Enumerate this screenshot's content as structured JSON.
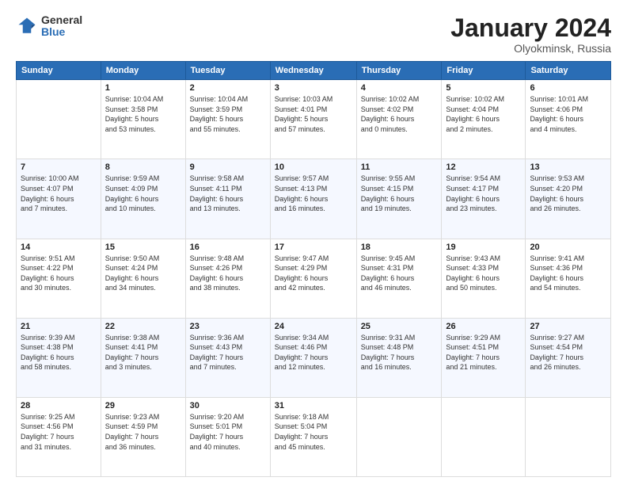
{
  "header": {
    "logo_general": "General",
    "logo_blue": "Blue",
    "month": "January 2024",
    "location": "Olyokminsk, Russia"
  },
  "weekdays": [
    "Sunday",
    "Monday",
    "Tuesday",
    "Wednesday",
    "Thursday",
    "Friday",
    "Saturday"
  ],
  "weeks": [
    [
      {
        "day": "",
        "info": ""
      },
      {
        "day": "1",
        "info": "Sunrise: 10:04 AM\nSunset: 3:58 PM\nDaylight: 5 hours\nand 53 minutes."
      },
      {
        "day": "2",
        "info": "Sunrise: 10:04 AM\nSunset: 3:59 PM\nDaylight: 5 hours\nand 55 minutes."
      },
      {
        "day": "3",
        "info": "Sunrise: 10:03 AM\nSunset: 4:01 PM\nDaylight: 5 hours\nand 57 minutes."
      },
      {
        "day": "4",
        "info": "Sunrise: 10:02 AM\nSunset: 4:02 PM\nDaylight: 6 hours\nand 0 minutes."
      },
      {
        "day": "5",
        "info": "Sunrise: 10:02 AM\nSunset: 4:04 PM\nDaylight: 6 hours\nand 2 minutes."
      },
      {
        "day": "6",
        "info": "Sunrise: 10:01 AM\nSunset: 4:06 PM\nDaylight: 6 hours\nand 4 minutes."
      }
    ],
    [
      {
        "day": "7",
        "info": "Sunrise: 10:00 AM\nSunset: 4:07 PM\nDaylight: 6 hours\nand 7 minutes."
      },
      {
        "day": "8",
        "info": "Sunrise: 9:59 AM\nSunset: 4:09 PM\nDaylight: 6 hours\nand 10 minutes."
      },
      {
        "day": "9",
        "info": "Sunrise: 9:58 AM\nSunset: 4:11 PM\nDaylight: 6 hours\nand 13 minutes."
      },
      {
        "day": "10",
        "info": "Sunrise: 9:57 AM\nSunset: 4:13 PM\nDaylight: 6 hours\nand 16 minutes."
      },
      {
        "day": "11",
        "info": "Sunrise: 9:55 AM\nSunset: 4:15 PM\nDaylight: 6 hours\nand 19 minutes."
      },
      {
        "day": "12",
        "info": "Sunrise: 9:54 AM\nSunset: 4:17 PM\nDaylight: 6 hours\nand 23 minutes."
      },
      {
        "day": "13",
        "info": "Sunrise: 9:53 AM\nSunset: 4:20 PM\nDaylight: 6 hours\nand 26 minutes."
      }
    ],
    [
      {
        "day": "14",
        "info": "Sunrise: 9:51 AM\nSunset: 4:22 PM\nDaylight: 6 hours\nand 30 minutes."
      },
      {
        "day": "15",
        "info": "Sunrise: 9:50 AM\nSunset: 4:24 PM\nDaylight: 6 hours\nand 34 minutes."
      },
      {
        "day": "16",
        "info": "Sunrise: 9:48 AM\nSunset: 4:26 PM\nDaylight: 6 hours\nand 38 minutes."
      },
      {
        "day": "17",
        "info": "Sunrise: 9:47 AM\nSunset: 4:29 PM\nDaylight: 6 hours\nand 42 minutes."
      },
      {
        "day": "18",
        "info": "Sunrise: 9:45 AM\nSunset: 4:31 PM\nDaylight: 6 hours\nand 46 minutes."
      },
      {
        "day": "19",
        "info": "Sunrise: 9:43 AM\nSunset: 4:33 PM\nDaylight: 6 hours\nand 50 minutes."
      },
      {
        "day": "20",
        "info": "Sunrise: 9:41 AM\nSunset: 4:36 PM\nDaylight: 6 hours\nand 54 minutes."
      }
    ],
    [
      {
        "day": "21",
        "info": "Sunrise: 9:39 AM\nSunset: 4:38 PM\nDaylight: 6 hours\nand 58 minutes."
      },
      {
        "day": "22",
        "info": "Sunrise: 9:38 AM\nSunset: 4:41 PM\nDaylight: 7 hours\nand 3 minutes."
      },
      {
        "day": "23",
        "info": "Sunrise: 9:36 AM\nSunset: 4:43 PM\nDaylight: 7 hours\nand 7 minutes."
      },
      {
        "day": "24",
        "info": "Sunrise: 9:34 AM\nSunset: 4:46 PM\nDaylight: 7 hours\nand 12 minutes."
      },
      {
        "day": "25",
        "info": "Sunrise: 9:31 AM\nSunset: 4:48 PM\nDaylight: 7 hours\nand 16 minutes."
      },
      {
        "day": "26",
        "info": "Sunrise: 9:29 AM\nSunset: 4:51 PM\nDaylight: 7 hours\nand 21 minutes."
      },
      {
        "day": "27",
        "info": "Sunrise: 9:27 AM\nSunset: 4:54 PM\nDaylight: 7 hours\nand 26 minutes."
      }
    ],
    [
      {
        "day": "28",
        "info": "Sunrise: 9:25 AM\nSunset: 4:56 PM\nDaylight: 7 hours\nand 31 minutes."
      },
      {
        "day": "29",
        "info": "Sunrise: 9:23 AM\nSunset: 4:59 PM\nDaylight: 7 hours\nand 36 minutes."
      },
      {
        "day": "30",
        "info": "Sunrise: 9:20 AM\nSunset: 5:01 PM\nDaylight: 7 hours\nand 40 minutes."
      },
      {
        "day": "31",
        "info": "Sunrise: 9:18 AM\nSunset: 5:04 PM\nDaylight: 7 hours\nand 45 minutes."
      },
      {
        "day": "",
        "info": ""
      },
      {
        "day": "",
        "info": ""
      },
      {
        "day": "",
        "info": ""
      }
    ]
  ]
}
